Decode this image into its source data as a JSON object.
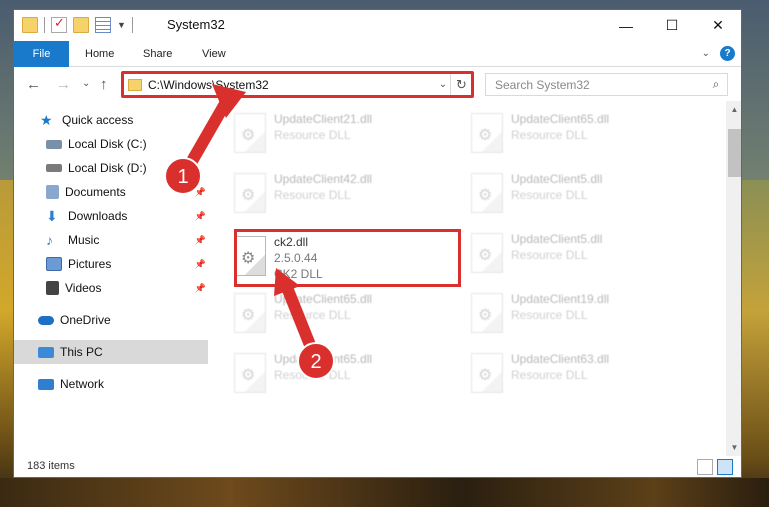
{
  "titlebar": {
    "title": "System32",
    "minimize": "—",
    "maximize": "☐",
    "close": "✕"
  },
  "ribbon": {
    "tabs": [
      "File",
      "Home",
      "Share",
      "View"
    ],
    "accent": "#1979ca",
    "help": "?",
    "expand": "⌄"
  },
  "address": {
    "path": "C:\\Windows\\System32",
    "dropdown": "⌄",
    "refresh": "↻"
  },
  "nav_buttons": {
    "back": "←",
    "forward": "→",
    "recent": "⌄",
    "up": "↑"
  },
  "search": {
    "placeholder": "Search System32",
    "icon": "⌕"
  },
  "sidebar": {
    "items": [
      {
        "label": "Quick access",
        "icon": "star-icon",
        "color": "#1979ca",
        "pinned": false
      },
      {
        "label": "Local Disk (C:)",
        "icon": "drive-icon",
        "color": "#7a8fa8",
        "pinned": false
      },
      {
        "label": "Local Disk (D:)",
        "icon": "drive-icon",
        "color": "#7a7a7a",
        "pinned": false
      },
      {
        "label": "Documents",
        "icon": "documents-icon",
        "color": "#8aa7cf",
        "pinned": true
      },
      {
        "label": "Downloads",
        "icon": "downloads-icon",
        "color": "#2f7fd1",
        "pinned": true
      },
      {
        "label": "Music",
        "icon": "music-icon",
        "color": "#2f7fd1",
        "pinned": true
      },
      {
        "label": "Pictures",
        "icon": "pictures-icon",
        "color": "#6b9bd4",
        "pinned": true
      },
      {
        "label": "Videos",
        "icon": "videos-icon",
        "color": "#444444",
        "pinned": true
      },
      {
        "label": "OneDrive",
        "icon": "cloud-icon",
        "color": "#1f6fc2",
        "pinned": false
      },
      {
        "label": "This PC",
        "icon": "computer-icon",
        "color": "#3a8ad8",
        "pinned": false,
        "selected": true
      },
      {
        "label": "Network",
        "icon": "network-icon",
        "color": "#2f7fd1",
        "pinned": false
      }
    ]
  },
  "files": [
    {
      "name": "UpdateClient21.dll",
      "type": "Resource DLL",
      "faded": true
    },
    {
      "name": "UpdateClient65.dll",
      "type": "Resource DLL",
      "faded": true
    },
    {
      "name": "UpdateClient42.dll",
      "type": "Resource DLL",
      "faded": true
    },
    {
      "name": "UpdateClient5.dll",
      "type": "Resource DLL",
      "faded": true
    },
    {
      "name": "ck2.dll",
      "version": "2.5.0.44",
      "type": "CK2 DLL",
      "faded": false
    },
    {
      "name": "UpdateClient5.dll",
      "type": "Resource DLL",
      "faded": true
    },
    {
      "name": "UpdateClient65.dll",
      "type": "Resource DLL",
      "faded": true
    },
    {
      "name": "UpdateClient19.dll",
      "type": "Resource DLL",
      "faded": true
    },
    {
      "name": "UpdateClient65.dll",
      "type": "Resource DLL",
      "faded": true
    },
    {
      "name": "UpdateClient63.dll",
      "type": "Resource DLL",
      "faded": true
    }
  ],
  "status": {
    "count": "183 items"
  },
  "annotations": {
    "badge1": "1",
    "badge2": "2",
    "color": "#d9302d"
  }
}
